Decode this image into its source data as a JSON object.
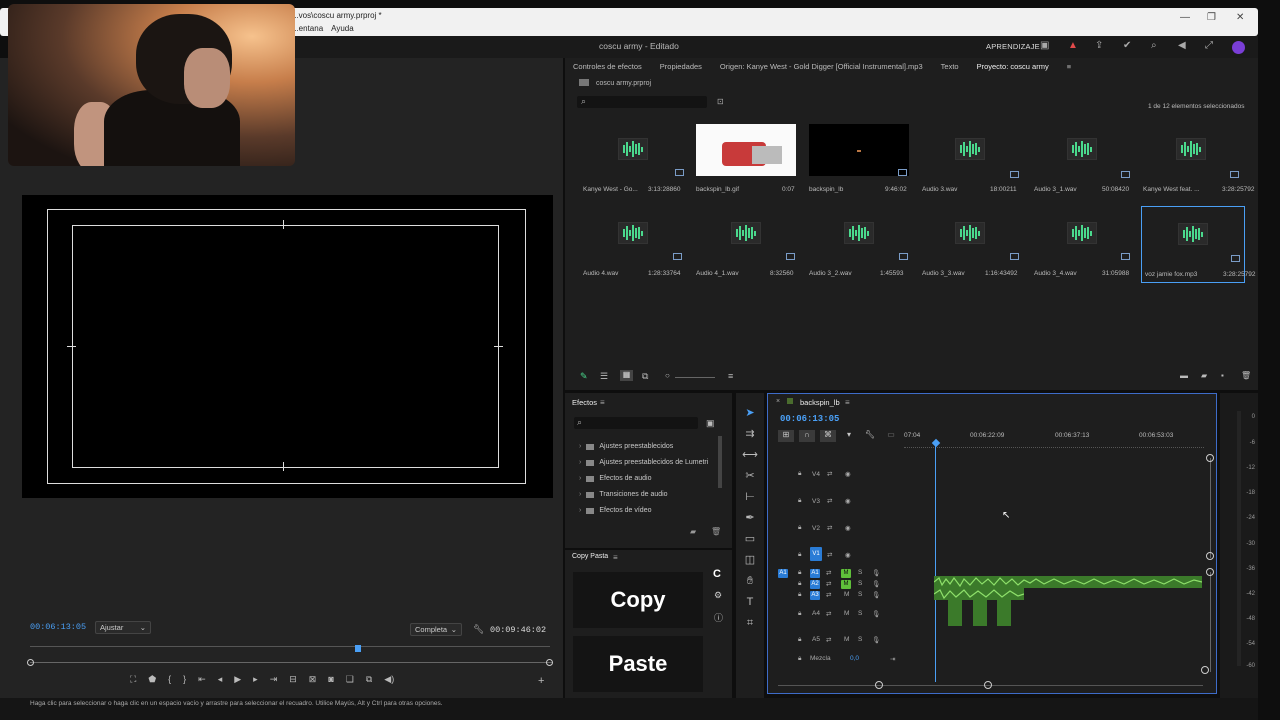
{
  "window": {
    "title": "...vos\\coscu army.prproj *",
    "menus": [
      "...entana",
      "Ayuda"
    ]
  },
  "appbar": {
    "document": "coscu army - Editado",
    "learn": "APRENDIZAJE"
  },
  "source_monitor": {
    "timecode": "00:06:13:05",
    "fit": "Ajustar",
    "quality": "Completa",
    "duration": "00:09:46:02"
  },
  "project": {
    "tabs": [
      "Controles de efectos",
      "Propiedades",
      "Origen: Kanye West - Gold Digger [Official Instrumental].mp3",
      "Texto",
      "Proyecto: coscu army"
    ],
    "file": "coscu army.prproj",
    "selection": "1 de 12 elementos seleccionados",
    "items": [
      {
        "name": "Kanye West - Go...",
        "duration": "3:13:28860",
        "kind": "audio"
      },
      {
        "name": "backspin_lb.gif",
        "duration": "0:07",
        "kind": "gif"
      },
      {
        "name": "backspin_lb",
        "duration": "9:46:02",
        "kind": "sequence"
      },
      {
        "name": "Audio 3.wav",
        "duration": "18:00211",
        "kind": "audio"
      },
      {
        "name": "Audio 3_1.wav",
        "duration": "50:08420",
        "kind": "audio"
      },
      {
        "name": "Kanye West feat. ...",
        "duration": "3:28:25792",
        "kind": "audio"
      },
      {
        "name": "Audio 4.wav",
        "duration": "1:28:33764",
        "kind": "audio"
      },
      {
        "name": "Audio 4_1.wav",
        "duration": "8:32560",
        "kind": "audio"
      },
      {
        "name": "Audio 3_2.wav",
        "duration": "1:45593",
        "kind": "audio"
      },
      {
        "name": "Audio 3_3.wav",
        "duration": "1:16:43492",
        "kind": "audio"
      },
      {
        "name": "Audio 3_4.wav",
        "duration": "31:05988",
        "kind": "audio"
      },
      {
        "name": "voz jamie fox.mp3",
        "duration": "3:28:25792",
        "kind": "audio"
      }
    ]
  },
  "effects": {
    "title": "Efectos",
    "items": [
      "Ajustes preestablecidos",
      "Ajustes preestablecidos de Lumetri",
      "Efectos de audio",
      "Transiciones de audio",
      "Efectos de vídeo"
    ]
  },
  "copypasta": {
    "title": "Copy Pasta",
    "copy": "Copy",
    "paste": "Paste"
  },
  "timeline": {
    "sequence": "backspin_lb",
    "timecode": "00:06:13:05",
    "ruler": [
      "07:04",
      "00:06:22:09",
      "00:06:37:13",
      "00:06:53:03"
    ],
    "video_tracks": [
      "V4",
      "V3",
      "V2",
      "V1"
    ],
    "audio_tracks": [
      "A1",
      "A2",
      "A3",
      "A4",
      "A5"
    ],
    "mix_label": "Mezcla",
    "mix_value": "0,0",
    "source_label": "A1",
    "m_label": "M",
    "s_label": "S"
  },
  "meter": {
    "levels": [
      "0",
      "-6",
      "-12",
      "-18",
      "-24",
      "-30",
      "-36",
      "-42",
      "-48",
      "-54",
      "-60",
      "dB"
    ]
  },
  "status": "Haga clic para seleccionar o haga clic en un espacio vacío y arrastre para seleccionar el recuadro. Utilice Mayús, Alt y Ctrl para otras opciones.",
  "colors": {
    "accent": "#4a9ff5",
    "audio_clip": "#5fbf3a",
    "wave": "#4ad98d"
  }
}
